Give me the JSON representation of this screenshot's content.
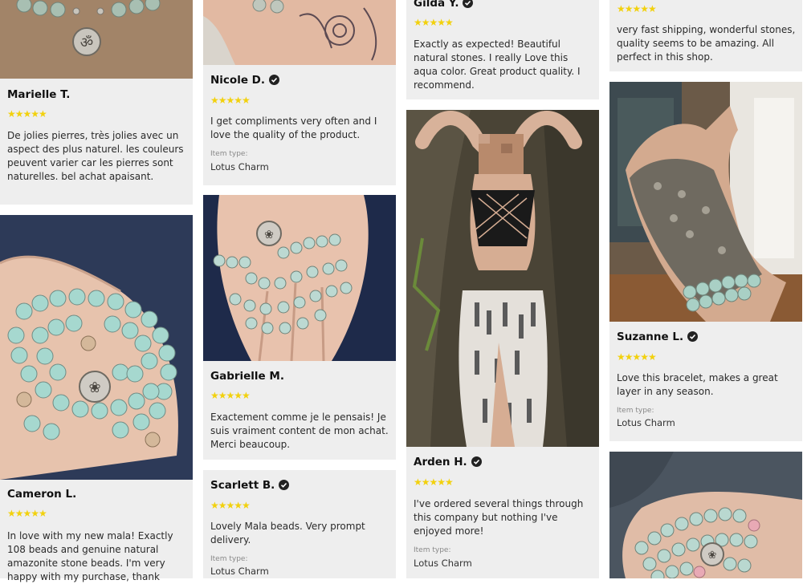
{
  "reviews": [
    {
      "name": "Marielle T.",
      "verified": false,
      "stars": "★★★★★",
      "text": "De jolies pierres, très jolies avec un aspect des plus naturel. les couleurs peuvent varier car les pierres sont naturelles. bel achat apaisant.",
      "item_type_label": "",
      "item_type": ""
    },
    {
      "name": "Cameron L.",
      "verified": false,
      "stars": "★★★★★",
      "text": "In love with my new mala! Exactly 108 beads and genuine natural amazonite stone beads. I'm very happy with my purchase, thank",
      "item_type_label": "",
      "item_type": ""
    },
    {
      "name": "Nicole D.",
      "verified": true,
      "stars": "★★★★★",
      "text": "I get compliments very often and I love the quality of the product.",
      "item_type_label": "Item type:",
      "item_type": "Lotus Charm"
    },
    {
      "name": "Gabrielle M.",
      "verified": false,
      "stars": "★★★★★",
      "text": "Exactement comme je le pensais! Je suis vraiment content de mon achat. Merci beaucoup.",
      "item_type_label": "",
      "item_type": ""
    },
    {
      "name": "Scarlett B.",
      "verified": true,
      "stars": "★★★★★",
      "text": "Lovely Mala beads. Very prompt delivery.",
      "item_type_label": "Item type:",
      "item_type": "Lotus Charm"
    },
    {
      "name": "Gilda Y.",
      "verified": true,
      "stars": "★★★★★",
      "text": "Exactly as expected! Beautiful natural stones. I really Love this aqua color. Great product quality. I recommend.",
      "item_type_label": "",
      "item_type": ""
    },
    {
      "name": "Arden H.",
      "verified": true,
      "stars": "★★★★★",
      "text": "I've ordered several things through this company but nothing I've enjoyed more!",
      "item_type_label": "Item type:",
      "item_type": "Lotus Charm"
    },
    {
      "name": "",
      "verified": false,
      "stars": "★★★★★",
      "text": "very fast shipping, wonderful stones, quality seems to be amazing. All perfect in this shop.",
      "item_type_label": "",
      "item_type": ""
    },
    {
      "name": "Suzanne L.",
      "verified": true,
      "stars": "★★★★★",
      "text": "Love this bracelet, makes a great layer in any season.",
      "item_type_label": "Item type:",
      "item_type": "Lotus Charm"
    }
  ],
  "photos": [
    {
      "name": "photo-mala-om-charm"
    },
    {
      "name": "photo-mala-in-hand"
    },
    {
      "name": "photo-tattooed-wrist"
    },
    {
      "name": "photo-mala-wrapped-hand"
    },
    {
      "name": "photo-woman-wearing-bracelets"
    },
    {
      "name": "photo-bracelet-layered-glove"
    },
    {
      "name": "photo-mala-on-wrist"
    }
  ],
  "colors": {
    "card_bg": "#eeeeee",
    "star": "#f2d10d",
    "text": "#2a2a2a",
    "name": "#111111"
  }
}
